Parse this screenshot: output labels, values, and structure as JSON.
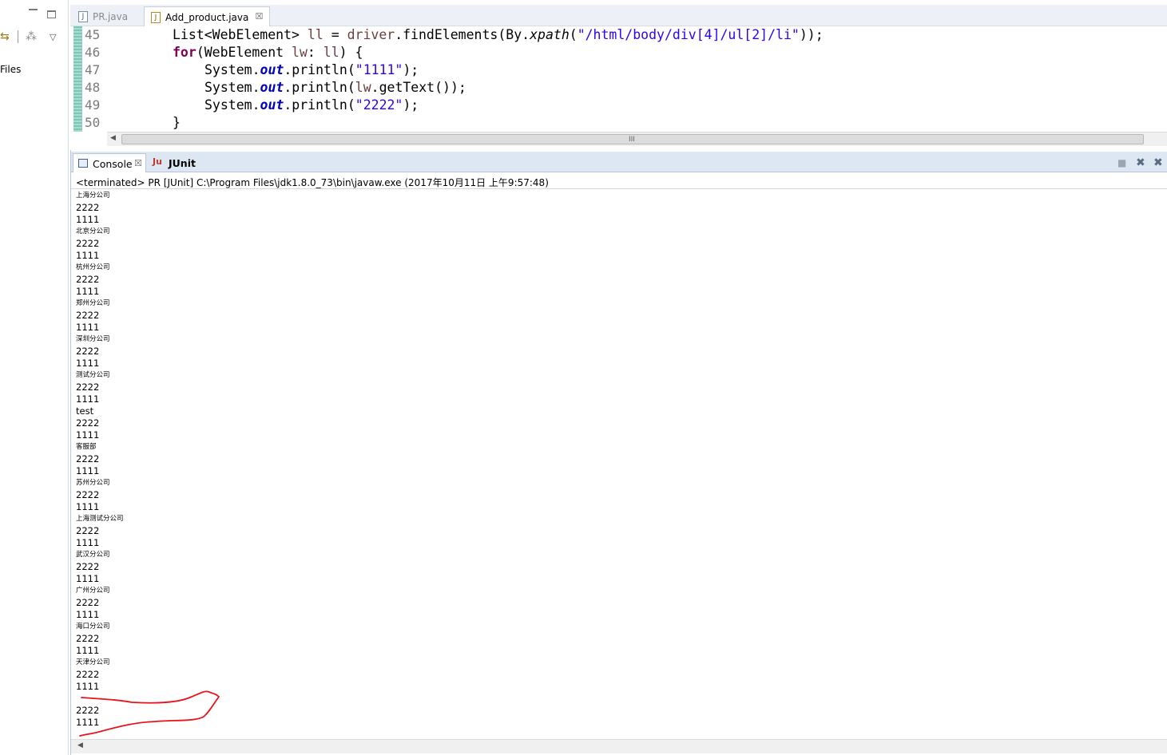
{
  "left_panel": {
    "partial_label": "Files",
    "minimize_icon": "minimize-icon",
    "maximize_icon": "maximize-icon",
    "link_icon": "link-editor-icon",
    "focus_icon": "focus-icon",
    "menu_icon": "view-menu-icon"
  },
  "editor": {
    "tabs": [
      {
        "label": "PR.java",
        "icon": "java-file-icon",
        "active": false
      },
      {
        "label": "Add_product.java",
        "icon": "java-file-icon",
        "active": true,
        "close": "☒"
      }
    ],
    "lines": [
      {
        "number": "45"
      },
      {
        "number": "46"
      },
      {
        "number": "47"
      },
      {
        "number": "48"
      },
      {
        "number": "49"
      },
      {
        "number": "50"
      }
    ],
    "code": {
      "l45_a": "List<WebElement> ",
      "l45_b": "ll",
      "l45_c": " = ",
      "l45_d": "driver",
      "l45_e": ".findElements(By.",
      "l45_f": "xpath",
      "l45_g": "(",
      "l45_h": "\"/html/body/div[4]/ul[2]/li\"",
      "l45_i": "));",
      "l46_a": "for",
      "l46_b": "(WebElement ",
      "l46_c": "lw",
      "l46_d": ": ",
      "l46_e": "ll",
      "l46_f": ") {",
      "l47_a": "System.",
      "l47_b": "out",
      "l47_c": ".println(",
      "l47_d": "\"1111\"",
      "l47_e": ");",
      "l48_a": "System.",
      "l48_b": "out",
      "l48_c": ".println(",
      "l48_d": "lw",
      "l48_e": ".getText());",
      "l49_a": "System.",
      "l49_b": "out",
      "l49_c": ".println(",
      "l49_d": "\"2222\"",
      "l49_e": ");",
      "l50_a": "}"
    },
    "scroll_grip": "III"
  },
  "console": {
    "tabs": [
      {
        "label": "Console",
        "close": "☒"
      },
      {
        "label": "JUnit"
      }
    ],
    "status": "<terminated> PR [JUnit] C:\\Program Files\\jdk1.8.0_73\\bin\\javaw.exe (2017年10月11日 上午9:57:48)",
    "output": [
      "上海分公司",
      "2222",
      "1111",
      "北京分公司",
      "2222",
      "1111",
      "杭州分公司",
      "2222",
      "1111",
      "郑州分公司",
      "2222",
      "1111",
      "深圳分公司",
      "2222",
      "1111",
      "测试分公司",
      "2222",
      "1111",
      "test",
      "2222",
      "1111",
      "客服部",
      "2222",
      "1111",
      "苏州分公司",
      "2222",
      "1111",
      "上海测试分公司",
      "2222",
      "1111",
      "武汉分公司",
      "2222",
      "1111",
      "广州分公司",
      "2222",
      "1111",
      "海口分公司",
      "2222",
      "1111",
      "天津分公司",
      "2222",
      "1111",
      "",
      "2222",
      "1111"
    ],
    "annotation_color": "#e8141c"
  }
}
